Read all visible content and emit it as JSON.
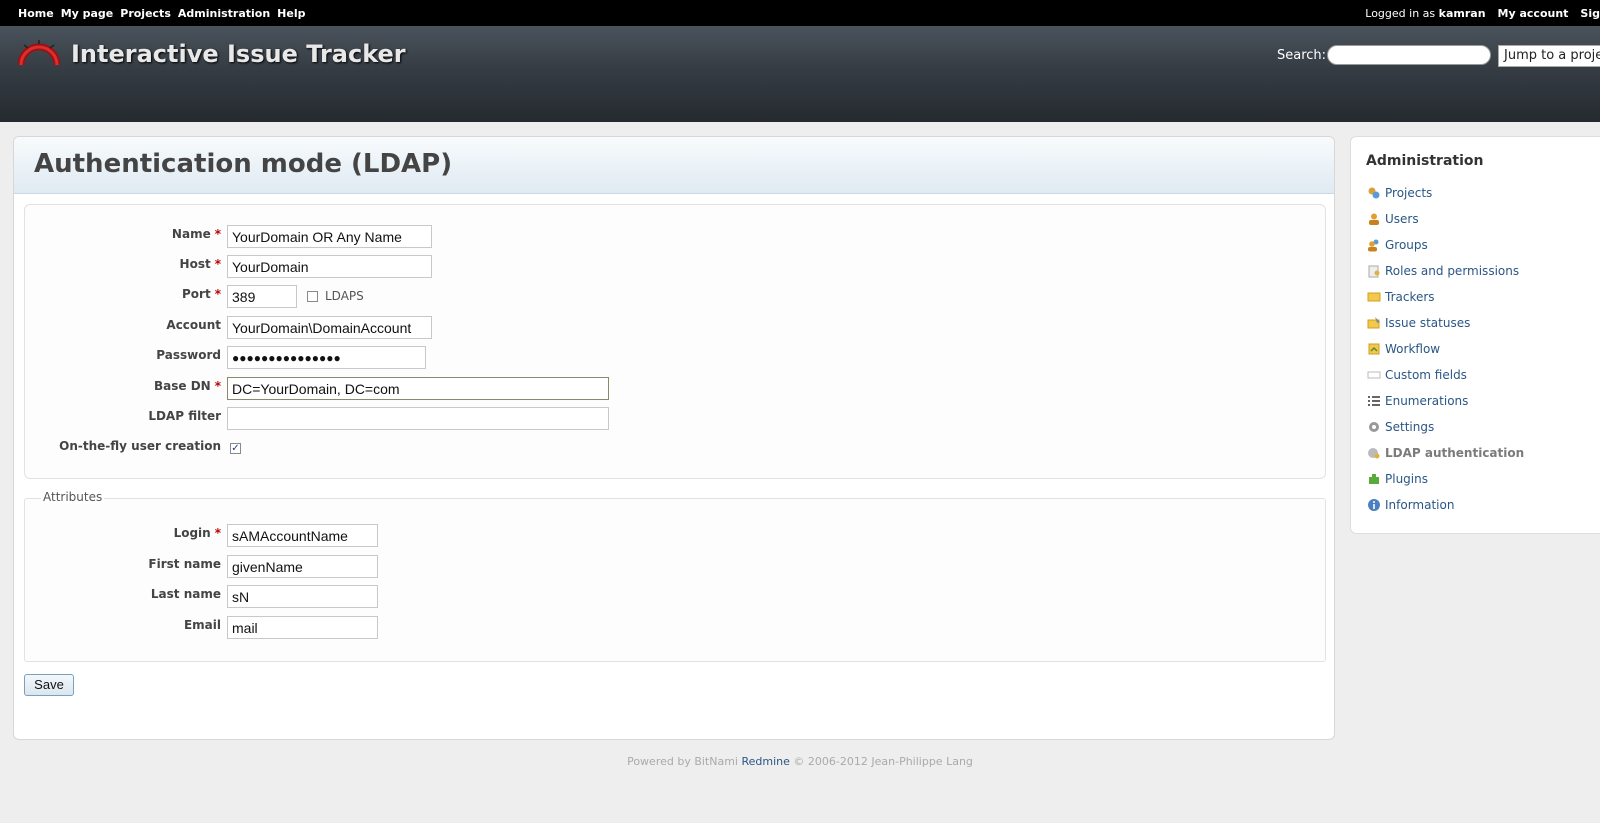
{
  "top_menu": {
    "left_items": [
      "Home",
      "My page",
      "Projects",
      "Administration",
      "Help"
    ],
    "logged_in_prefix": "Logged in as",
    "username": "kamran",
    "my_account": "My account",
    "sign_out": "Sig"
  },
  "header": {
    "title": "Interactive Issue Tracker",
    "search_label": "Search:",
    "search_value": "",
    "jump_label": "Jump to a projec"
  },
  "page": {
    "title": "Authentication mode (LDAP)"
  },
  "form": {
    "name_label": "Name",
    "name_value": "YourDomain OR Any Name",
    "host_label": "Host",
    "host_value": "YourDomain",
    "port_label": "Port",
    "port_value": "389",
    "ldaps_label": "LDAPS",
    "ldaps_checked": false,
    "account_label": "Account",
    "account_value": "YourDomain\\DomainAccount",
    "password_label": "Password",
    "password_value": "●●●●●●●●●●●●●●●",
    "base_dn_label": "Base DN",
    "base_dn_value": "DC=YourDomain, DC=com",
    "ldap_filter_label": "LDAP filter",
    "ldap_filter_value": "",
    "onthefly_label": "On-the-fly user creation",
    "onthefly_checked": true,
    "required_marker": "*"
  },
  "attributes": {
    "legend": "Attributes",
    "login_label": "Login",
    "login_value": "sAMAccountName",
    "firstname_label": "First name",
    "firstname_value": "givenName",
    "lastname_label": "Last name",
    "lastname_value": "sN",
    "email_label": "Email",
    "email_value": "mail"
  },
  "save_label": "Save",
  "sidebar": {
    "title": "Administration",
    "items": [
      {
        "label": "Projects",
        "icon": "projects-icon"
      },
      {
        "label": "Users",
        "icon": "user-icon"
      },
      {
        "label": "Groups",
        "icon": "group-icon"
      },
      {
        "label": "Roles and permissions",
        "icon": "key-icon"
      },
      {
        "label": "Trackers",
        "icon": "ticket-icon"
      },
      {
        "label": "Issue statuses",
        "icon": "status-icon"
      },
      {
        "label": "Workflow",
        "icon": "workflow-icon"
      },
      {
        "label": "Custom fields",
        "icon": "custom-fields-icon"
      },
      {
        "label": "Enumerations",
        "icon": "list-icon"
      },
      {
        "label": "Settings",
        "icon": "gear-icon"
      },
      {
        "label": "LDAP authentication",
        "icon": "server-key-icon",
        "selected": true
      },
      {
        "label": "Plugins",
        "icon": "plugin-icon"
      },
      {
        "label": "Information",
        "icon": "info-icon"
      }
    ]
  },
  "footer": {
    "prefix": "Powered by BitNami",
    "link": "Redmine",
    "suffix": "© 2006-2012 Jean-Philippe Lang"
  },
  "colors": {
    "link": "#2a5685",
    "required": "#bb0000",
    "header_top": "#4a535c",
    "header_bottom": "#252a2f"
  }
}
